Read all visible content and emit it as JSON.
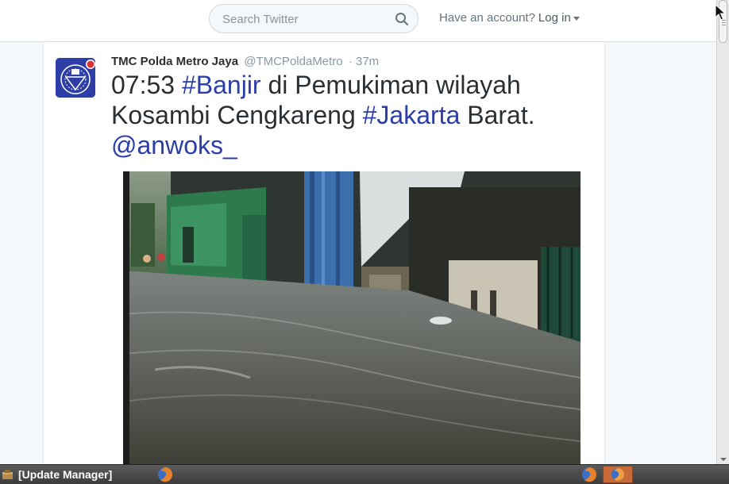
{
  "search": {
    "placeholder": "Search Twitter"
  },
  "account": {
    "prompt": "Have an account?",
    "login_label": "Log in"
  },
  "tweet": {
    "author_name": "TMC Polda Metro Jaya",
    "author_handle": "@TMCPoldaMetro",
    "separator": "·",
    "time": "37m",
    "text": {
      "t1": "07:53 ",
      "hashtag1": "#Banjir",
      "t2": " di Pemukiman wilayah Kosambi Cengkareng ",
      "hashtag2": "#Jakarta",
      "t3": " Barat. ",
      "mention": "@anwoks_"
    },
    "colors": {
      "link": "#2b3ea8",
      "text": "#292f33",
      "muted": "#8899a6"
    }
  },
  "taskbar": {
    "window_label": "[Update Manager]",
    "icons": [
      "update-manager-icon",
      "firefox-icon",
      "firefox-icon",
      "firefox-icon"
    ]
  }
}
